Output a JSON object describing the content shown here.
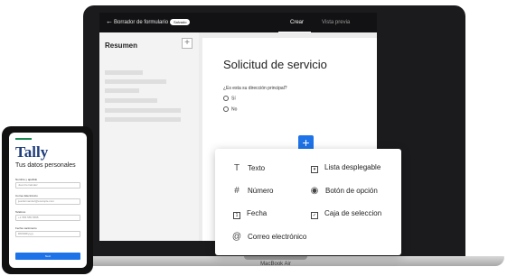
{
  "laptop": {
    "topbar": {
      "back_icon": "arrow-left-icon",
      "back_glyph": "←",
      "draft_label": "Borrador de formulario",
      "saved_badge": "Salvado",
      "tab_create": "Crear",
      "tab_preview": "Vista previa"
    },
    "sidebar": {
      "title": "Resumen",
      "add_glyph": "+"
    },
    "form": {
      "title": "Solicitud de servicio",
      "question": "¿Es esta su dirección principal?",
      "options": [
        "Sí",
        "No"
      ],
      "add_block_glyph": "+"
    },
    "model_label": "MacBook Air"
  },
  "menu": {
    "items": [
      {
        "icon": "text-icon",
        "glyph": "T",
        "label": "Texto"
      },
      {
        "icon": "dropdown-icon",
        "glyph": "▾",
        "label": "Lista desplegable"
      },
      {
        "icon": "number-icon",
        "glyph": "#",
        "label": "Número"
      },
      {
        "icon": "radio-option-icon",
        "glyph": "◉",
        "label": "Botón de opción"
      },
      {
        "icon": "date-icon",
        "glyph": "1",
        "label": "Fecha"
      },
      {
        "icon": "checkbox-icon",
        "glyph": "✓",
        "label": "Caja de seleccion"
      },
      {
        "icon": "email-icon",
        "glyph": "@",
        "label": "Correo electrónico"
      }
    ]
  },
  "phone": {
    "logo": "Tally",
    "title": "Tus datos personales",
    "fields": [
      {
        "label": "Nombre y apellido",
        "placeholder": "Juan Fernández"
      },
      {
        "label": "Correo Electrónico",
        "placeholder": "juanfernandez@example.com"
      },
      {
        "label": "Teléfono",
        "placeholder": "+1 555 555 5555"
      },
      {
        "label": "Fecha nacimiento",
        "placeholder": "DD/MM/yyyy"
      }
    ],
    "submit_label": "Next"
  },
  "colors": {
    "accent_blue": "#1e73e8",
    "tally_navy": "#1e3d7a",
    "progress_green": "#1a8a52",
    "topbar_dark": "#121214"
  }
}
